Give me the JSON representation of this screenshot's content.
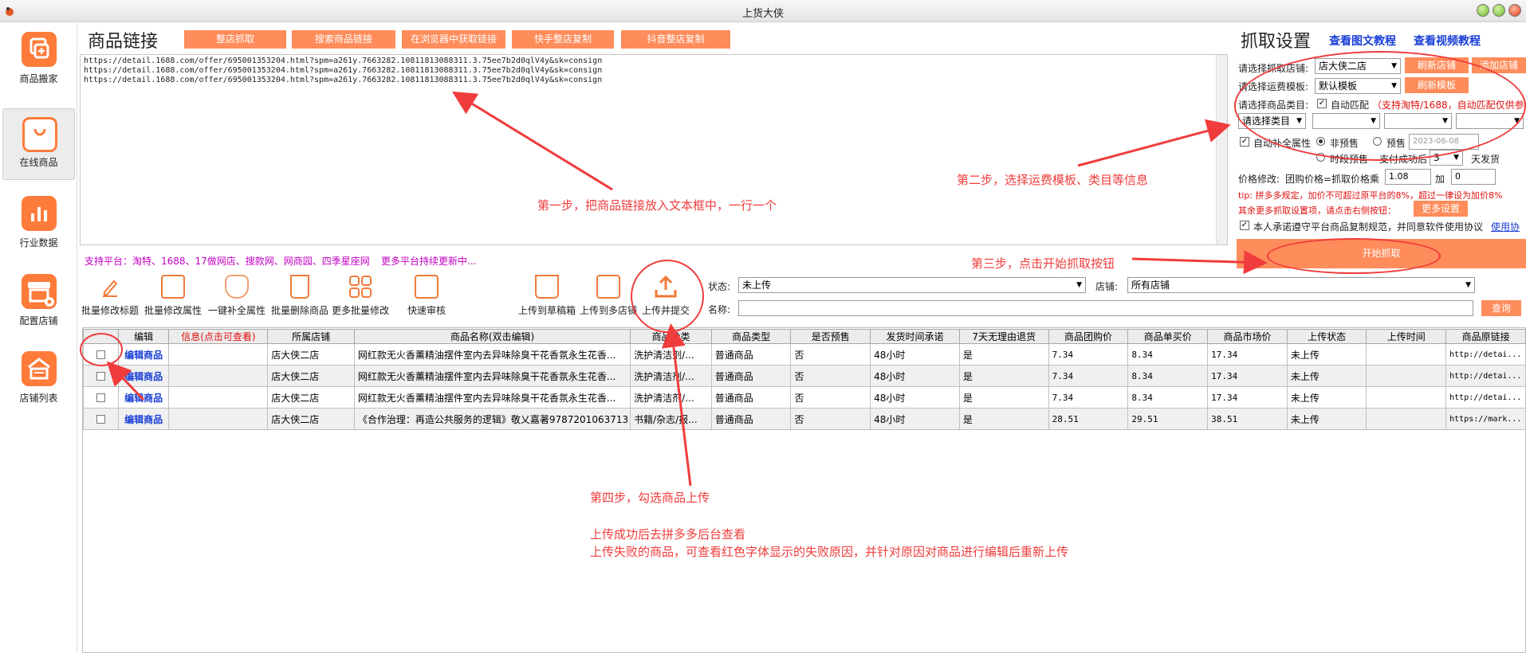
{
  "window": {
    "title": "上货大侠"
  },
  "sidebar": {
    "items": [
      {
        "label": "商品搬家",
        "icon": "copy-icon"
      },
      {
        "label": "在线商品",
        "icon": "shopping-bag-icon"
      },
      {
        "label": "行业数据",
        "icon": "bar-chart-icon"
      },
      {
        "label": "配置店铺",
        "icon": "store-settings-icon"
      },
      {
        "label": "店铺列表",
        "icon": "store-list-icon"
      }
    ]
  },
  "main": {
    "heading": "商品链接",
    "buttons": [
      "整店抓取",
      "搜索商品链接",
      "在浏览器中获取链接",
      "快手整店复制",
      "抖音整店复制"
    ],
    "urls": "https://detail.1688.com/offer/695001353204.html?spm=a261y.7663282.10811813088311.3.75ee7b2d0qlV4y&sk=consign\nhttps://detail.1688.com/offer/695001353204.html?spm=a261y.7663282.10811813088311.3.75ee7b2d0qlV4y&sk=consign\nhttps://detail.1688.com/offer/695001353204.html?spm=a261y.7663282.10811813088311.3.75ee7b2d0qlV4y&sk=consign",
    "platforms": "支持平台：淘特、1688、17做网店、搜款网、网商园、四季星座网",
    "more_platforms": "更多平台持续更新中..."
  },
  "annotations": {
    "step1": "第一步，把商品链接放入文本框中，一行一个",
    "step2": "第二步，选择运费模板、类目等信息",
    "step3": "第三步，点击开始抓取按钮",
    "step4": "第四步，勾选商品上传",
    "note1": "上传成功后去拼多多后台查看",
    "note2": "上传失败的商品，可查看红色字体显示的失败原因，并针对原因对商品进行编辑后重新上传"
  },
  "toolbar": {
    "items": [
      "批量修改标题",
      "批量修改属性",
      "一键补全属性",
      "批量删除商品",
      "更多批量修改",
      "快速审核",
      "上传到草稿箱",
      "上传到多店铺",
      "上传并提交"
    ]
  },
  "filters": {
    "status_label": "状态:",
    "status_value": "未上传",
    "shop_label": "店铺:",
    "shop_value": "所有店铺",
    "name_label": "名称:",
    "name_value": "",
    "search": "查询"
  },
  "settings": {
    "title": "抓取设置",
    "tutorial_text": "查看图文教程",
    "tutorial_video": "查看视频教程",
    "shop_label": "请选择抓取店铺:",
    "shop_value": "店大侠二店",
    "refresh_shop": "刷新店铺",
    "add_shop": "添加店铺",
    "freight_label": "请选择运费模板:",
    "freight_value": "默认模板",
    "refresh_tpl": "刷新模板",
    "category_label": "请选择商品类目:",
    "auto_match": "自动匹配",
    "auto_match_note": "（支持淘特/1688，自动匹配仅供参考",
    "category_placeholder": "请选择类目",
    "auto_fill": "自动补全属性",
    "no_presale": "非预售",
    "presale": "预售",
    "date": "2023-06-08",
    "period_presale": "时段预售",
    "pay_after": "支付成功后",
    "days_value": "3",
    "days_suffix": "天发货",
    "price_label": "价格修改:",
    "price_formula": "团购价格=抓取价格乘",
    "multiplier": "1.08",
    "plus_label": "加",
    "plus_value": "0",
    "tip": "tip: 拼多多规定，加价不可超过原平台的8%，超过一律设为加价8%",
    "more_tip": "其余更多抓取设置项，请点击右侧按钮：",
    "more_btn": "更多设置",
    "agree": "本人承诺遵守平台商品复制规范，并同意软件使用协议",
    "agree_link": "使用协",
    "start": "开始抓取"
  },
  "table": {
    "headers": [
      "",
      "编辑",
      "信息(点击可查看)",
      "所属店铺",
      "商品名称(双击编辑)",
      "商品分类",
      "商品类型",
      "是否预售",
      "发货时间承诺",
      "7天无理由退货",
      "商品团购价",
      "商品单买价",
      "商品市场价",
      "上传状态",
      "上传时间",
      "商品原链接"
    ],
    "rows": [
      [
        "",
        "编辑商品",
        "",
        "店大侠二店",
        "网红款无火香薰精油摆件室内去异味除臭干花香氛永生花香...",
        "洗护清洁剂/...",
        "普通商品",
        "否",
        "48小时",
        "是",
        "7.34",
        "8.34",
        "17.34",
        "未上传",
        "",
        "http://detai..."
      ],
      [
        "",
        "编辑商品",
        "",
        "店大侠二店",
        "网红款无火香薰精油摆件室内去异味除臭干花香氛永生花香...",
        "洗护清洁剂/...",
        "普通商品",
        "否",
        "48小时",
        "是",
        "7.34",
        "8.34",
        "17.34",
        "未上传",
        "",
        "http://detai..."
      ],
      [
        "",
        "编辑商品",
        "",
        "店大侠二店",
        "网红款无火香薰精油摆件室内去异味除臭干花香氛永生花香...",
        "洗护清洁剂/...",
        "普通商品",
        "否",
        "48小时",
        "是",
        "7.34",
        "8.34",
        "17.34",
        "未上传",
        "",
        "http://detai..."
      ],
      [
        "",
        "编辑商品",
        "",
        "店大侠二店",
        "《合作治理：再造公共服务的逻辑》敬乂嘉著9787201063713",
        "书籍/杂志/报...",
        "普通商品",
        "否",
        "48小时",
        "是",
        "28.51",
        "29.51",
        "38.51",
        "未上传",
        "",
        "https://mark..."
      ]
    ]
  },
  "colors": {
    "accent": "#ff8c5a",
    "annotation": "#f03c3c",
    "link": "#1a3fd6",
    "platform": "#c000c0"
  }
}
